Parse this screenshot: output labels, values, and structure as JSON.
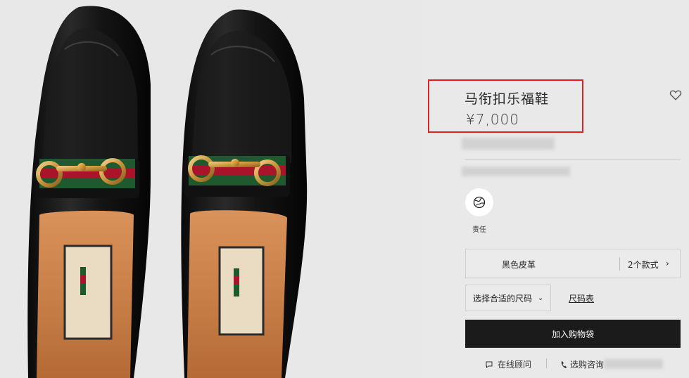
{
  "product": {
    "name": "马衔扣乐福鞋",
    "price": "¥7,000"
  },
  "responsibility": {
    "label": "责任",
    "icon": "globe-icon"
  },
  "variant": {
    "color_label": "黑色皮革",
    "count_label": "2个款式",
    "chevron": "›"
  },
  "size": {
    "select_label": "选择合适的尺码",
    "chevron": "⌄",
    "chart_link": "尺码表"
  },
  "cart": {
    "add_label": "加入购物袋"
  },
  "support": {
    "chat_label": "在线顾问",
    "consult_label": "选购咨询"
  },
  "colors": {
    "highlight_box": "#e02020",
    "primary_button": "#1b1b1b",
    "background": "#e9e9e9"
  }
}
